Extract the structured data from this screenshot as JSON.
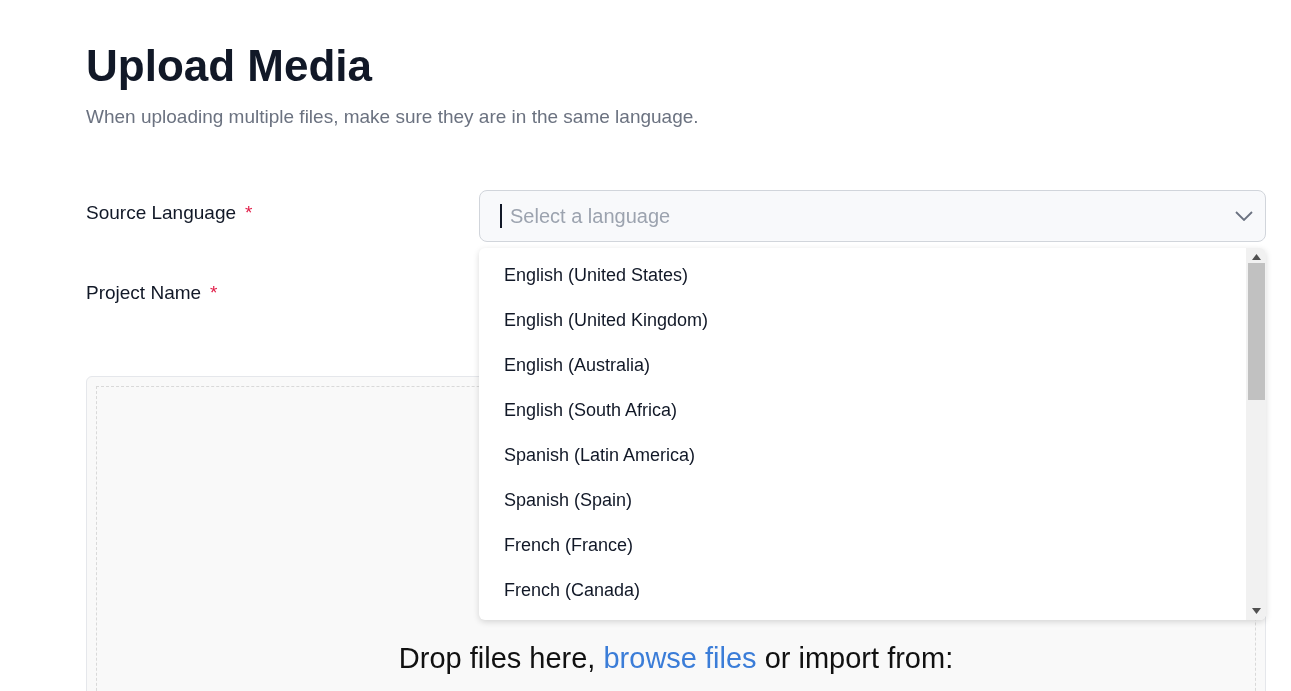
{
  "header": {
    "title": "Upload Media",
    "subtitle": "When uploading multiple files, make sure they are in the same language."
  },
  "fields": [
    {
      "kind": "select",
      "label": "Source Language",
      "required_mark": "*",
      "placeholder": "Select a language",
      "expanded": true,
      "options": [
        "English (United States)",
        "English (United Kingdom)",
        "English (Australia)",
        "English (South Africa)",
        "Spanish (Latin America)",
        "Spanish (Spain)",
        "French (France)",
        "French (Canada)"
      ]
    },
    {
      "kind": "text",
      "label": "Project Name",
      "required_mark": "*"
    }
  ],
  "dropzone": {
    "text_before": "Drop files here, ",
    "link": "browse files",
    "text_after": " or import from:"
  }
}
